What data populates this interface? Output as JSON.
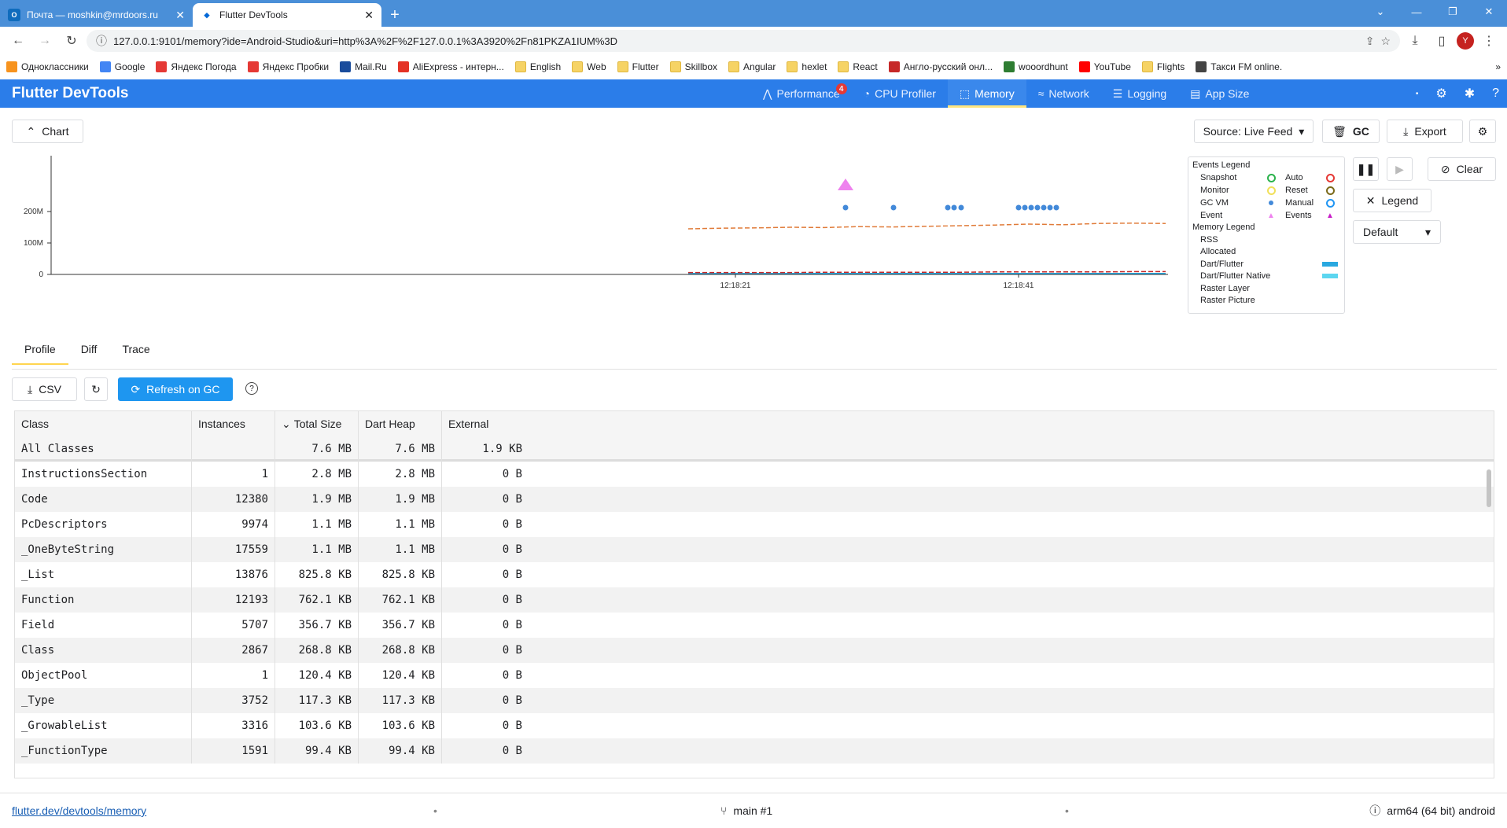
{
  "browser": {
    "tabs": [
      {
        "title": "Почта — moshkin@mrdoors.ru",
        "icon": "outlook-icon",
        "active": false
      },
      {
        "title": "Flutter DevTools",
        "icon": "flutter-icon",
        "active": true
      }
    ],
    "url": "127.0.0.1:9101/memory?ide=Android-Studio&uri=http%3A%2F%2F127.0.0.1%3A3920%2Fn81PKZA1IUM%3D",
    "profile_initial": "Y",
    "bookmarks": [
      {
        "label": "Одноклассники",
        "color": "#f7931e"
      },
      {
        "label": "Google",
        "color": "#4285f4"
      },
      {
        "label": "Яндекс Погода",
        "color": "#e53935"
      },
      {
        "label": "Яндекс Пробки",
        "color": "#e53935"
      },
      {
        "label": "Mail.Ru",
        "color": "#1a4c9c"
      },
      {
        "label": "AliExpress - интерн...",
        "color": "#e43225"
      },
      {
        "label": "English",
        "folder": true
      },
      {
        "label": "Web",
        "folder": true
      },
      {
        "label": "Flutter",
        "folder": true
      },
      {
        "label": "Skillbox",
        "folder": true
      },
      {
        "label": "Angular",
        "folder": true
      },
      {
        "label": "hexlet",
        "folder": true
      },
      {
        "label": "React",
        "folder": true
      },
      {
        "label": "Англо-русский онл...",
        "color": "#c62828"
      },
      {
        "label": "wooordhunt",
        "color": "#2e7d32"
      },
      {
        "label": "YouTube",
        "color": "#ff0000"
      },
      {
        "label": "Flights",
        "folder": true
      },
      {
        "label": "Такси FM online.",
        "color": "#444444"
      }
    ]
  },
  "app": {
    "title": "Flutter DevTools",
    "nav": [
      {
        "label": "Performance",
        "icon": "performance-icon",
        "badge": "4"
      },
      {
        "label": "CPU Profiler",
        "icon": "cpu-profiler-icon"
      },
      {
        "label": "Memory",
        "icon": "memory-icon",
        "selected": true
      },
      {
        "label": "Network",
        "icon": "network-icon"
      },
      {
        "label": "Logging",
        "icon": "logging-icon"
      },
      {
        "label": "App Size",
        "icon": "app-size-icon"
      }
    ],
    "accent_color": "#2b7de9"
  },
  "memory": {
    "chart_toggle_label": "Chart",
    "source_label": "Source: Live Feed",
    "gc_label": "GC",
    "export_label": "Export",
    "clear_label": "Clear",
    "legend_label": "Legend",
    "display_interval": "Default",
    "events_legend": {
      "title": "Events Legend",
      "left": [
        {
          "label": "Snapshot",
          "symbol": "ring",
          "color": "#2bb24c"
        },
        {
          "label": "Monitor",
          "symbol": "ring",
          "color": "#f1e05a"
        },
        {
          "label": "GC VM",
          "symbol": "dot",
          "color": "#4289d9"
        },
        {
          "label": "Event",
          "symbol": "triangle",
          "color": "#ee82ee"
        }
      ],
      "right": [
        {
          "label": "Auto",
          "symbol": "ring",
          "color": "#e53935"
        },
        {
          "label": "Reset",
          "symbol": "ring",
          "color": "#7b6a1a"
        },
        {
          "label": "Manual",
          "symbol": "ring",
          "color": "#2196f3"
        },
        {
          "label": "Events",
          "symbol": "triangle",
          "color": "#c81ec8"
        }
      ]
    },
    "memory_legend": {
      "title": "Memory Legend",
      "items": [
        {
          "label": "RSS",
          "color": ""
        },
        {
          "label": "Allocated",
          "color": ""
        },
        {
          "label": "Dart/Flutter",
          "color": "#29a8e0"
        },
        {
          "label": "Dart/Flutter Native",
          "color": "#5cd6f0"
        },
        {
          "label": "Raster Layer",
          "color": ""
        },
        {
          "label": "Raster Picture",
          "color": ""
        }
      ]
    },
    "sub_tabs": [
      "Profile",
      "Diff",
      "Trace"
    ],
    "csv_label": "CSV",
    "refresh_on_gc_label": "Refresh on GC",
    "table": {
      "columns": [
        "Class",
        "Instances",
        "Total Size",
        "Dart Heap",
        "External"
      ],
      "sort_column": "Total Size",
      "summary": {
        "class": "All Classes",
        "instances": "",
        "total": "7.6 MB",
        "dart": "7.6 MB",
        "external": "1.9 KB"
      },
      "rows": [
        [
          "InstructionsSection",
          "1",
          "2.8 MB",
          "2.8 MB",
          "0 B"
        ],
        [
          "Code",
          "12380",
          "1.9 MB",
          "1.9 MB",
          "0 B"
        ],
        [
          "PcDescriptors",
          "9974",
          "1.1 MB",
          "1.1 MB",
          "0 B"
        ],
        [
          "_OneByteString",
          "17559",
          "1.1 MB",
          "1.1 MB",
          "0 B"
        ],
        [
          "_List",
          "13876",
          "825.8 KB",
          "825.8 KB",
          "0 B"
        ],
        [
          "Function",
          "12193",
          "762.1 KB",
          "762.1 KB",
          "0 B"
        ],
        [
          "Field",
          "5707",
          "356.7 KB",
          "356.7 KB",
          "0 B"
        ],
        [
          "Class",
          "2867",
          "268.8 KB",
          "268.8 KB",
          "0 B"
        ],
        [
          "ObjectPool",
          "1",
          "120.4 KB",
          "120.4 KB",
          "0 B"
        ],
        [
          "_Type",
          "3752",
          "117.3 KB",
          "117.3 KB",
          "0 B"
        ],
        [
          "_GrowableList",
          "3316",
          "103.6 KB",
          "103.6 KB",
          "0 B"
        ],
        [
          "_FunctionType",
          "1591",
          "99.4 KB",
          "99.4 KB",
          "0 B"
        ]
      ]
    }
  },
  "chart_data": {
    "type": "line",
    "y_tick_labels": [
      "0",
      "100M",
      "200M"
    ],
    "ylim": [
      0,
      400
    ],
    "x_tick_labels": [
      "12:18:21",
      "12:18:41"
    ],
    "series": [
      {
        "name": "RSS",
        "color": "#e07b39",
        "style": "dashed",
        "values": [
          145,
          147,
          148,
          150,
          149,
          152,
          151,
          153,
          155,
          157,
          160,
          158,
          162,
          163,
          162
        ]
      },
      {
        "name": "Dart/Flutter",
        "color": "#29a8e0",
        "style": "solid",
        "values": [
          3,
          3,
          3,
          3,
          3,
          3,
          3,
          3,
          3,
          3,
          3,
          3,
          3,
          3,
          3
        ]
      },
      {
        "name": "Allocated",
        "color": "#c62828",
        "style": "dashed",
        "values": [
          6,
          6,
          6,
          6,
          7,
          7,
          7,
          7,
          7,
          8,
          8,
          8,
          8,
          9,
          9
        ]
      }
    ],
    "gc_events_count": 13,
    "event_marker_count": 1
  },
  "status": {
    "link": "flutter.dev/devtools/memory",
    "isolate": "main #1",
    "device": "arm64 (64 bit) android"
  }
}
